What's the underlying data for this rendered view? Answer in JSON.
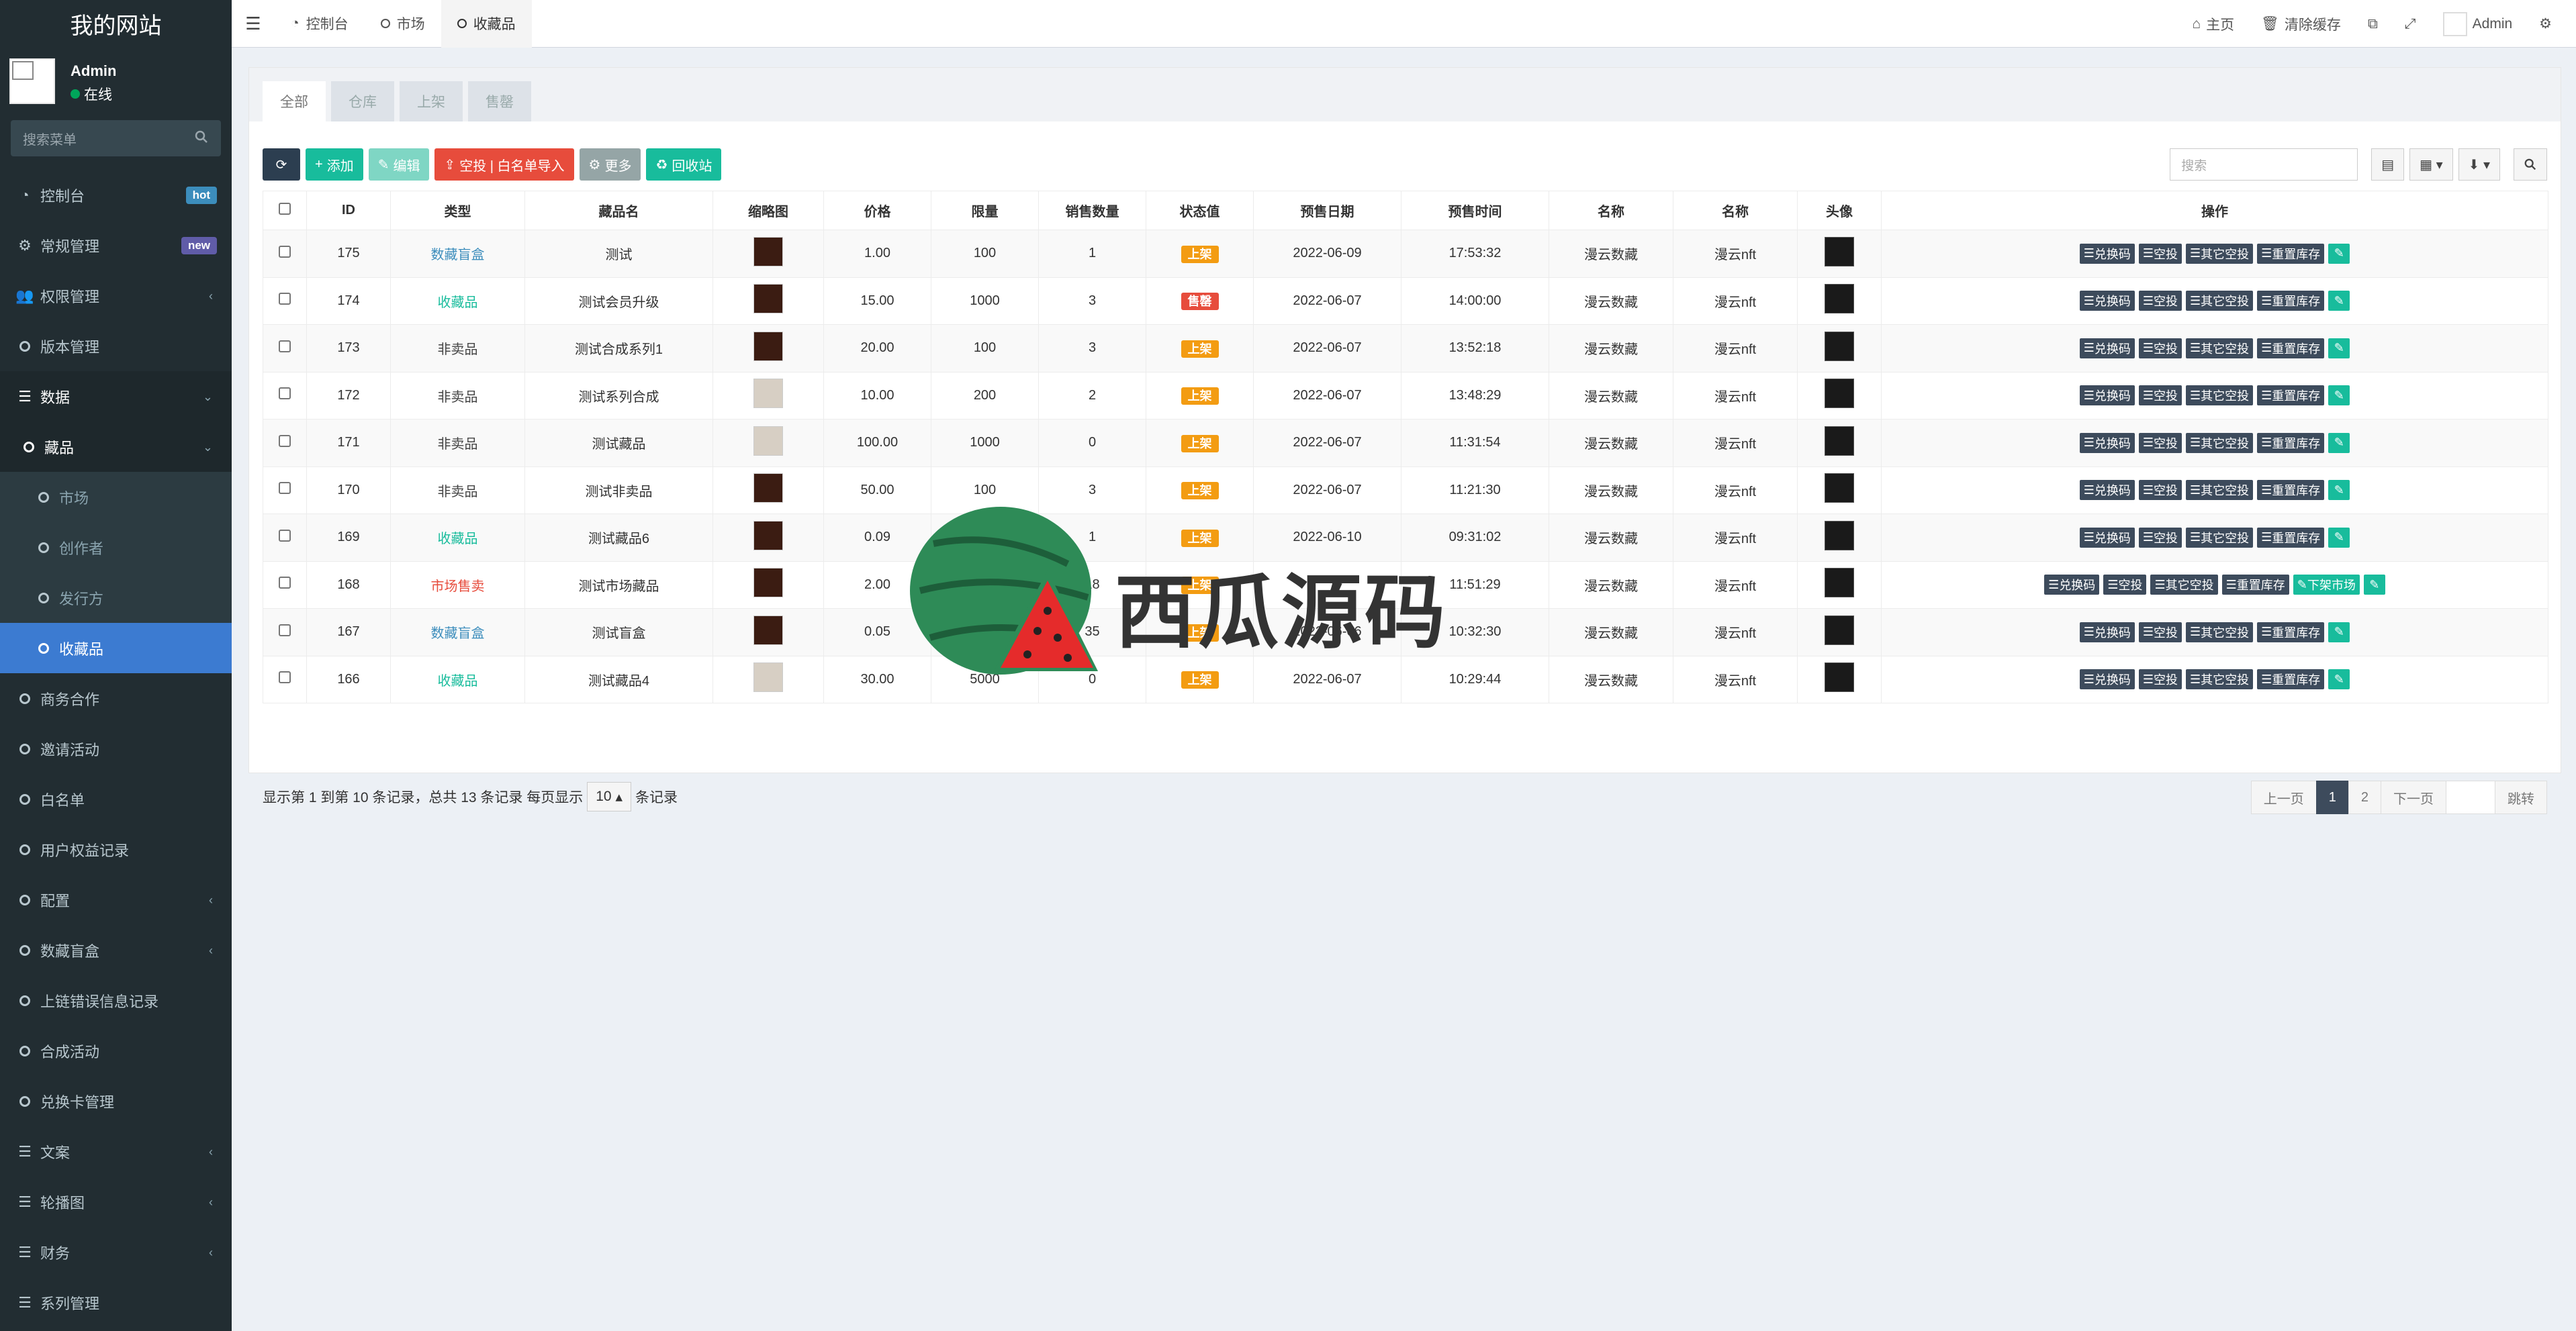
{
  "site": {
    "title": "我的网站"
  },
  "user": {
    "name": "Admin",
    "status": "在线"
  },
  "sidebar": {
    "search_placeholder": "搜索菜单",
    "items": [
      {
        "label": "控制台",
        "icon": "dashboard-icon",
        "badge": "hot",
        "badge_color": "#3c8dbc"
      },
      {
        "label": "常规管理",
        "icon": "cogs-icon",
        "badge": "new",
        "badge_color": "#605ca8"
      },
      {
        "label": "权限管理",
        "icon": "group-icon",
        "chevron": "‹"
      },
      {
        "label": "版本管理",
        "icon": "circle-icon"
      },
      {
        "label": "数据",
        "icon": "list-icon",
        "chevron": "⌄"
      },
      {
        "label": "藏品",
        "icon": "circle-icon",
        "chevron": "⌄"
      },
      {
        "label": "市场",
        "icon": "circle-icon"
      },
      {
        "label": "创作者",
        "icon": "circle-icon"
      },
      {
        "label": "发行方",
        "icon": "circle-icon"
      },
      {
        "label": "收藏品",
        "icon": "circle-icon"
      },
      {
        "label": "商务合作",
        "icon": "circle-icon"
      },
      {
        "label": "邀请活动",
        "icon": "circle-icon"
      },
      {
        "label": "白名单",
        "icon": "circle-icon"
      },
      {
        "label": "用户权益记录",
        "icon": "circle-icon"
      },
      {
        "label": "配置",
        "icon": "circle-icon",
        "chevron": "‹"
      },
      {
        "label": "数藏盲盒",
        "icon": "circle-icon",
        "chevron": "‹"
      },
      {
        "label": "上链错误信息记录",
        "icon": "circle-icon"
      },
      {
        "label": "合成活动",
        "icon": "circle-icon"
      },
      {
        "label": "兑换卡管理",
        "icon": "circle-icon"
      },
      {
        "label": "文案",
        "icon": "list-icon",
        "chevron": "‹"
      },
      {
        "label": "轮播图",
        "icon": "list-icon",
        "chevron": "‹"
      },
      {
        "label": "财务",
        "icon": "list-icon",
        "chevron": "‹"
      },
      {
        "label": "系列管理",
        "icon": "list-icon"
      }
    ]
  },
  "topbar": {
    "tabs": [
      "控制台",
      "市场",
      "收藏品"
    ],
    "home": "主页",
    "clear_cache": "清除缓存",
    "admin": "Admin"
  },
  "subtabs": [
    "全部",
    "仓库",
    "上架",
    "售罄"
  ],
  "toolbar": {
    "add": "添加",
    "edit": "编辑",
    "airdrop": "空投 | 白名单导入",
    "more": "更多",
    "recycle": "回收站",
    "search_placeholder": "搜索"
  },
  "table": {
    "columns": [
      "ID",
      "类型",
      "藏品名",
      "缩略图",
      "价格",
      "限量",
      "销售数量",
      "状态值",
      "预售日期",
      "预售时间",
      "名称",
      "名称",
      "头像",
      "操作"
    ],
    "rows": [
      {
        "id": "175",
        "type": "数藏盲盒",
        "type_color": "#3c8dbc",
        "name": "测试",
        "thumb": "dark",
        "price": "1.00",
        "limit": "100",
        "sold": "1",
        "status": "上架",
        "status_color": "#f39c12",
        "date": "2022-06-09",
        "time": "17:53:32",
        "name1": "漫云数藏",
        "name2": "漫云nft",
        "market": false
      },
      {
        "id": "174",
        "type": "收藏品",
        "type_color": "#18bc9c",
        "name": "测试会员升级",
        "thumb": "dark",
        "price": "15.00",
        "limit": "1000",
        "sold": "3",
        "status": "售罄",
        "status_color": "#e74c3c",
        "date": "2022-06-07",
        "time": "14:00:00",
        "name1": "漫云数藏",
        "name2": "漫云nft",
        "market": false
      },
      {
        "id": "173",
        "type": "非卖品",
        "type_color": "#444444",
        "name": "测试合成系列1",
        "thumb": "dark",
        "price": "20.00",
        "limit": "100",
        "sold": "3",
        "status": "上架",
        "status_color": "#f39c12",
        "date": "2022-06-07",
        "time": "13:52:18",
        "name1": "漫云数藏",
        "name2": "漫云nft",
        "market": false
      },
      {
        "id": "172",
        "type": "非卖品",
        "type_color": "#444444",
        "name": "测试系列合成",
        "thumb": "light",
        "price": "10.00",
        "limit": "200",
        "sold": "2",
        "status": "上架",
        "status_color": "#f39c12",
        "date": "2022-06-07",
        "time": "13:48:29",
        "name1": "漫云数藏",
        "name2": "漫云nft",
        "market": false
      },
      {
        "id": "171",
        "type": "非卖品",
        "type_color": "#444444",
        "name": "测试藏品",
        "thumb": "light",
        "price": "100.00",
        "limit": "1000",
        "sold": "0",
        "status": "上架",
        "status_color": "#f39c12",
        "date": "2022-06-07",
        "time": "11:31:54",
        "name1": "漫云数藏",
        "name2": "漫云nft",
        "market": false
      },
      {
        "id": "170",
        "type": "非卖品",
        "type_color": "#444444",
        "name": "测试非卖品",
        "thumb": "dark",
        "price": "50.00",
        "limit": "100",
        "sold": "3",
        "status": "上架",
        "status_color": "#f39c12",
        "date": "2022-06-07",
        "time": "11:21:30",
        "name1": "漫云数藏",
        "name2": "漫云nft",
        "market": false
      },
      {
        "id": "169",
        "type": "收藏品",
        "type_color": "#18bc9c",
        "name": "测试藏品6",
        "thumb": "dark",
        "price": "0.09",
        "limit": "",
        "sold": "1",
        "status": "上架",
        "status_color": "#f39c12",
        "date": "2022-06-10",
        "time": "09:31:02",
        "name1": "漫云数藏",
        "name2": "漫云nft",
        "market": false
      },
      {
        "id": "168",
        "type": "市场售卖",
        "type_color": "#e74c3c",
        "name": "测试市场藏品",
        "thumb": "dark",
        "price": "2.00",
        "limit": "",
        "sold": "18",
        "status": "上架",
        "status_color": "#f39c12",
        "date": "",
        "time": "11:51:29",
        "name1": "漫云数藏",
        "name2": "漫云nft",
        "market": true
      },
      {
        "id": "167",
        "type": "数藏盲盒",
        "type_color": "#3c8dbc",
        "name": "测试盲盒",
        "thumb": "dark",
        "price": "0.05",
        "limit": "",
        "sold": "35",
        "status": "上架",
        "status_color": "#f39c12",
        "date": "2022-06-06",
        "time": "10:32:30",
        "name1": "漫云数藏",
        "name2": "漫云nft",
        "market": false
      },
      {
        "id": "166",
        "type": "收藏品",
        "type_color": "#18bc9c",
        "name": "测试藏品4",
        "thumb": "light",
        "price": "30.00",
        "limit": "5000",
        "sold": "0",
        "status": "上架",
        "status_color": "#f39c12",
        "date": "2022-06-07",
        "time": "10:29:44",
        "name1": "漫云数藏",
        "name2": "漫云nft",
        "market": false
      }
    ],
    "ops": {
      "redeem": "兑换码",
      "airdrop": "空投",
      "other_airdrop": "其它空投",
      "reset_stock": "重置库存",
      "delist": "下架市场"
    }
  },
  "footer": {
    "info": "显示第 1 到第 10 条记录，总共 13 条记录 每页显示",
    "per_page": "10",
    "per_page_suffix": "条记录",
    "prev": "上一页",
    "pages": [
      "1",
      "2"
    ],
    "next": "下一页",
    "jump": "跳转"
  },
  "watermark": {
    "text": "西瓜源码"
  }
}
